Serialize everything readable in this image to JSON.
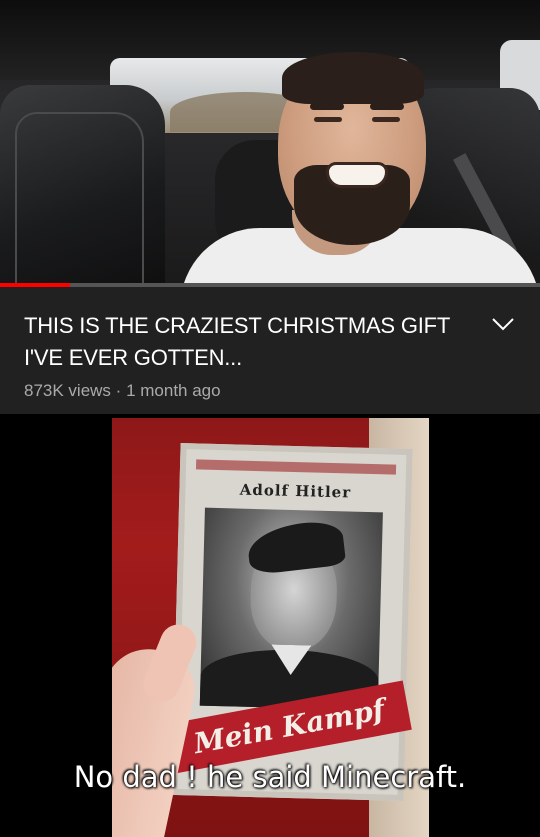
{
  "video": {
    "title": "THIS IS THE CRAZIEST CHRISTMAS GIFT I'VE EVER GOTTEN...",
    "views": "873K views",
    "separator": "·",
    "age": "1 month ago",
    "progress_fraction": 0.13,
    "expand_icon": "chevron-down-icon"
  },
  "meme": {
    "book_author": "Adolf Hitler",
    "book_title": "Mein Kampf",
    "caption": "No dad ! he said Minecraft."
  },
  "colors": {
    "panel_bg": "#212121",
    "title_text": "#ffffff",
    "meta_text": "#aaaaaa",
    "progress": "#ff0000"
  }
}
